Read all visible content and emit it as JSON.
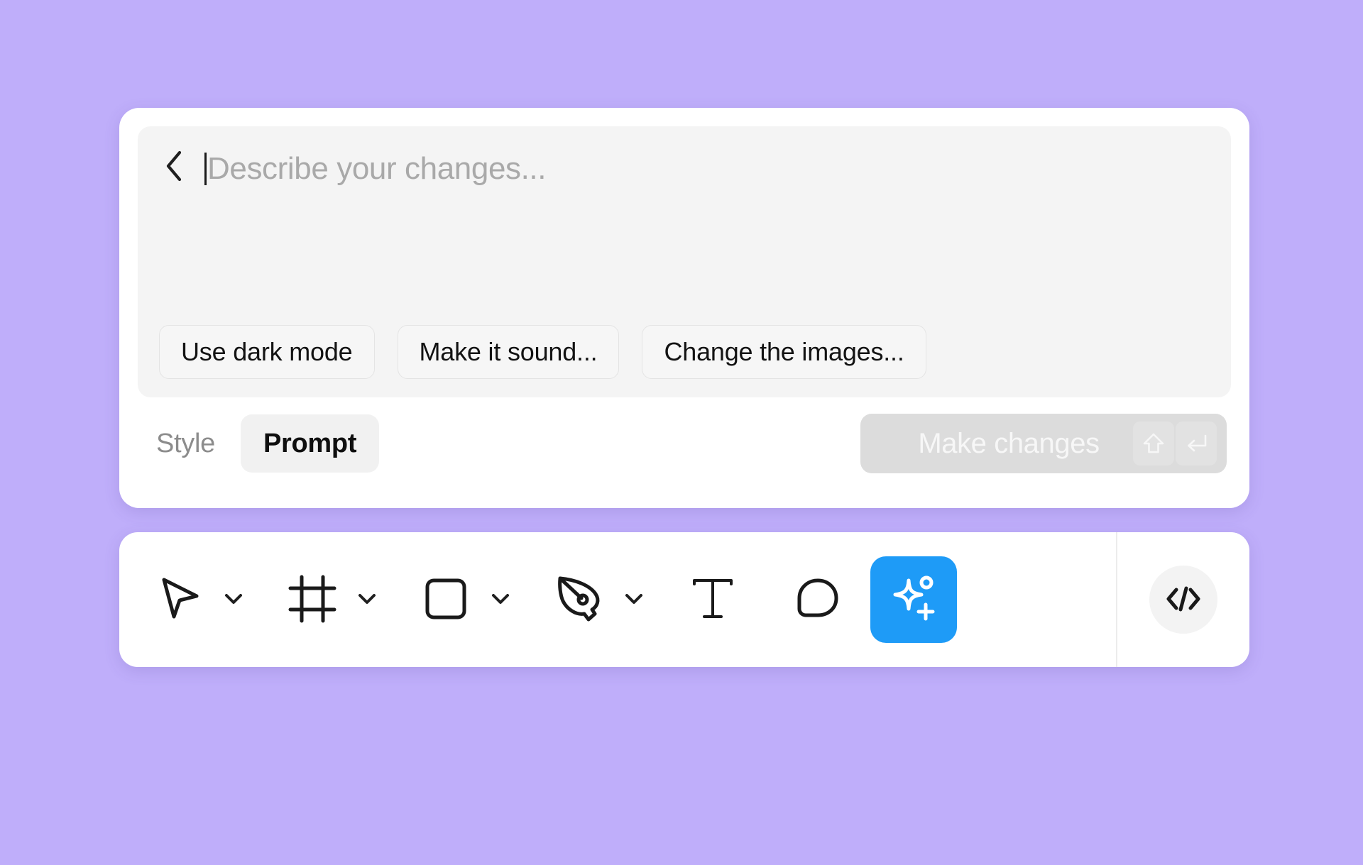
{
  "background_color": "#bfaefa",
  "prompt_card": {
    "back_button": {
      "icon": "chevron-left-icon"
    },
    "input": {
      "placeholder": "Describe your changes...",
      "value": "",
      "caret_visible": true,
      "placeholder_color": "#a9a9a9"
    },
    "suggestion_chips": [
      {
        "label": "Use dark mode"
      },
      {
        "label": "Make it sound..."
      },
      {
        "label": "Change the images..."
      }
    ],
    "footer": {
      "style_label": "Style",
      "mode_pill_label": "Prompt",
      "submit": {
        "label": "Make changes",
        "disabled": true,
        "background_color": "#dcdcdc",
        "keycaps": [
          {
            "name": "shift-key",
            "glyph": "⇧"
          },
          {
            "name": "enter-key",
            "glyph": "↵"
          }
        ]
      }
    }
  },
  "toolbar": {
    "tools": [
      {
        "name": "move-tool",
        "icon": "cursor-arrow-icon",
        "has_dropdown": true,
        "active": false
      },
      {
        "name": "frame-tool",
        "icon": "frame-icon",
        "has_dropdown": true,
        "active": false
      },
      {
        "name": "shape-tool",
        "icon": "rectangle-icon",
        "has_dropdown": true,
        "active": false
      },
      {
        "name": "pen-tool",
        "icon": "pen-icon",
        "has_dropdown": true,
        "active": false
      },
      {
        "name": "text-tool",
        "icon": "text-icon",
        "has_dropdown": false,
        "active": false
      },
      {
        "name": "comment-tool",
        "icon": "comment-icon",
        "has_dropdown": false,
        "active": false
      }
    ],
    "ai_button": {
      "name": "ai-generate-button",
      "icon": "sparkle-plus-icon",
      "color": "#1e9bf7",
      "active": true
    },
    "code_button": {
      "name": "dev-mode-button",
      "icon": "code-brackets-icon"
    }
  }
}
